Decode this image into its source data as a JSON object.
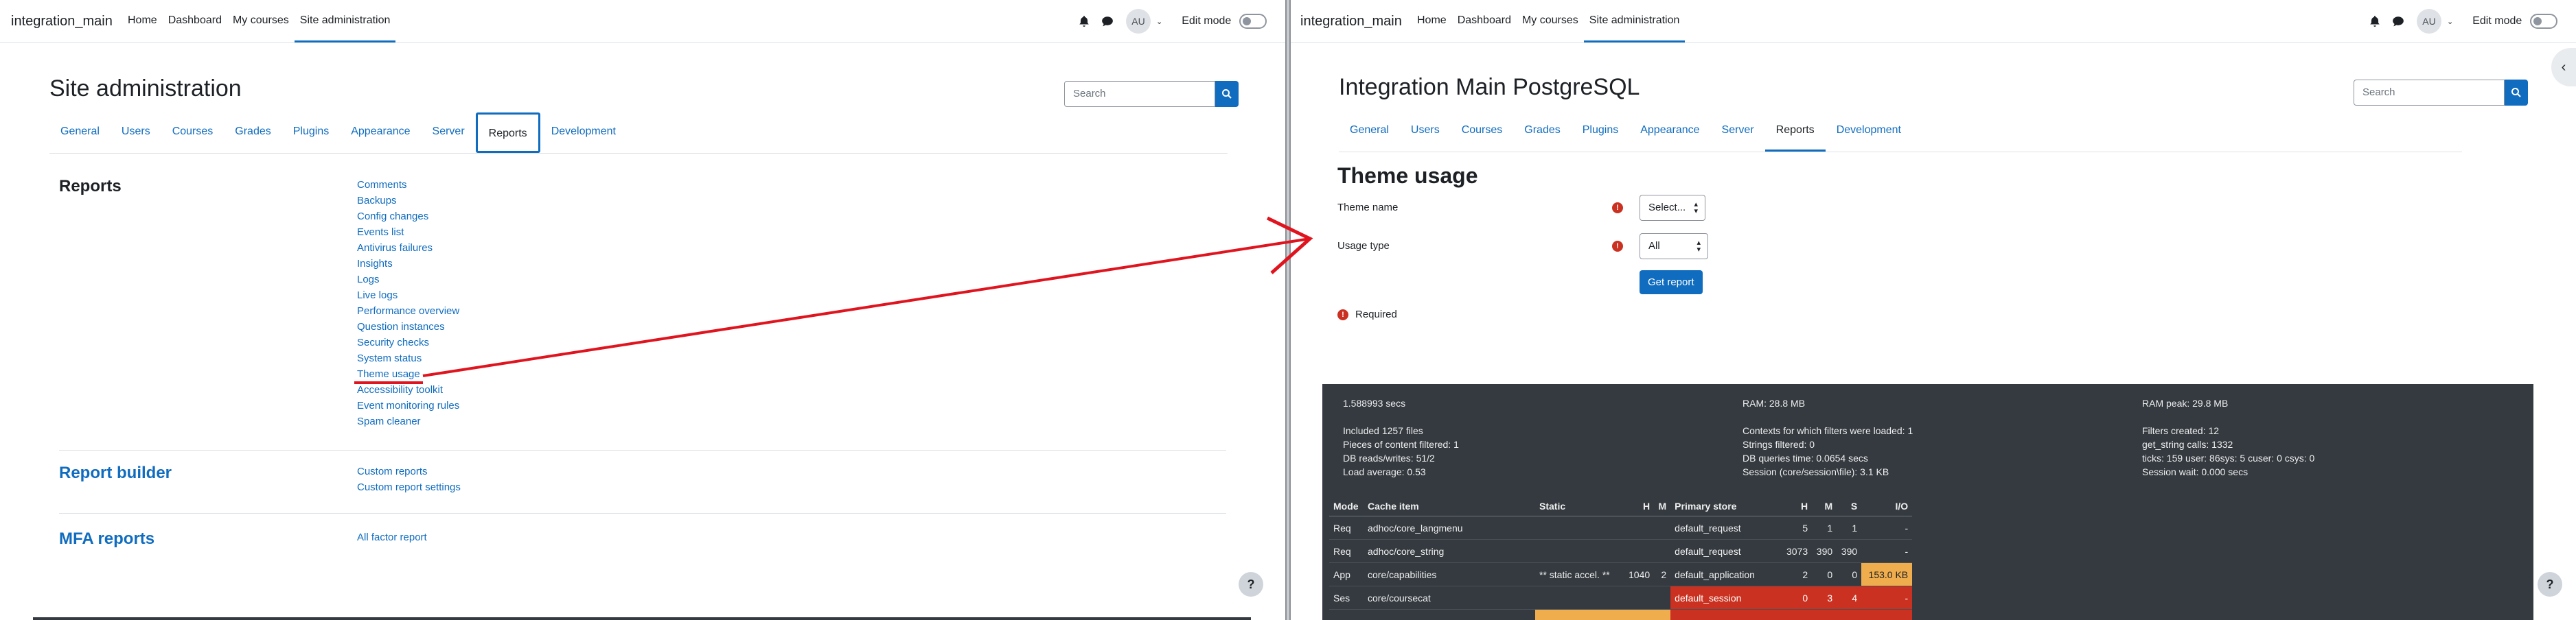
{
  "left": {
    "brand": "integration_main",
    "nav": [
      "Home",
      "Dashboard",
      "My courses",
      "Site administration"
    ],
    "avatar": "AU",
    "edit_mode": "Edit mode",
    "title": "Site administration",
    "search_placeholder": "Search",
    "tabs": [
      "General",
      "Users",
      "Courses",
      "Grades",
      "Plugins",
      "Appearance",
      "Server",
      "Reports",
      "Development"
    ],
    "active_tab": "Reports",
    "sections": [
      {
        "title": "Reports",
        "links": [
          "Comments",
          "Backups",
          "Config changes",
          "Events list",
          "Antivirus failures",
          "Insights",
          "Logs",
          "Live logs",
          "Performance overview",
          "Question instances",
          "Security checks",
          "System status",
          "Theme usage",
          "Accessibility toolkit",
          "Event monitoring rules",
          "Spam cleaner"
        ]
      },
      {
        "title": "Report builder",
        "links": [
          "Custom reports",
          "Custom report settings"
        ]
      },
      {
        "title": "MFA reports",
        "links": [
          "All factor report"
        ]
      }
    ],
    "help": "?"
  },
  "right": {
    "brand": "integration_main",
    "nav": [
      "Home",
      "Dashboard",
      "My courses",
      "Site administration"
    ],
    "avatar": "AU",
    "edit_mode": "Edit mode",
    "title": "Integration Main PostgreSQL",
    "search_placeholder": "Search",
    "tabs": [
      "General",
      "Users",
      "Courses",
      "Grades",
      "Plugins",
      "Appearance",
      "Server",
      "Reports",
      "Development"
    ],
    "active_tab": "Reports",
    "heading": "Theme usage",
    "form": {
      "theme_name_label": "Theme name",
      "theme_name_value": "Select...",
      "usage_type_label": "Usage type",
      "usage_type_value": "All",
      "submit": "Get report",
      "required": "Required"
    },
    "perf": {
      "col1": [
        "1.588993 secs",
        "",
        "Included 1257 files",
        "Pieces of content filtered: 1",
        "DB reads/writes: 51/2",
        "Load average: 0.53"
      ],
      "col2": [
        "RAM: 28.8 MB",
        "",
        "Contexts for which filters were loaded: 1",
        "Strings filtered: 0",
        "DB queries time: 0.0654 secs",
        "Session (core/session\\file): 3.1 KB"
      ],
      "col3": [
        "RAM peak: 29.8 MB",
        "",
        "Filters created: 12",
        "get_string calls: 1332",
        "ticks: 159 user: 86sys: 5 cuser: 0 csys: 0",
        "Session wait: 0.000 secs"
      ],
      "table_headers": [
        "Mode",
        "Cache item",
        "Static",
        "H",
        "M",
        "Primary store",
        "H",
        "M",
        "S",
        "I/O"
      ],
      "rows": [
        [
          "Req",
          "adhoc/core_langmenu",
          "",
          "",
          "",
          "default_request",
          "5",
          "1",
          "1",
          "-"
        ],
        [
          "Req",
          "adhoc/core_string",
          "",
          "",
          "",
          "default_request",
          "3073",
          "390",
          "390",
          "-"
        ],
        [
          "App",
          "core/capabilities",
          "** static accel. **",
          "1040",
          "2",
          "default_application",
          "2",
          "0",
          "0",
          "153.0 KB"
        ],
        [
          "Ses",
          "core/coursecat",
          "",
          "",
          "",
          "default_session",
          "0",
          "3",
          "4",
          "-"
        ]
      ]
    },
    "help": "?"
  }
}
